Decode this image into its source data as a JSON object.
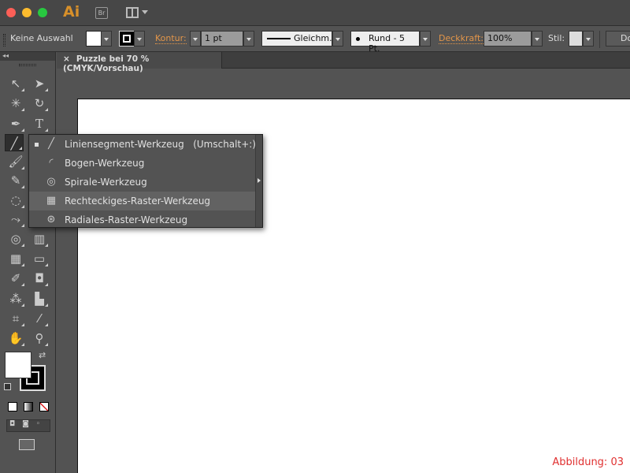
{
  "app": {
    "logo": "Ai",
    "bridge": "Br"
  },
  "control": {
    "selection": "Keine Auswahl",
    "stroke_label": "Kontur:",
    "stroke_weight": "1 pt",
    "stroke_profile": "Gleichm.",
    "brush": "Rund - 5 Pt.",
    "opacity_label": "Deckkraft:",
    "opacity": "100%",
    "style_label": "Stil:",
    "doc_button": "Do"
  },
  "tab": {
    "close": "×",
    "title": "Puzzle bei 70 % (CMYK/Vorschau)"
  },
  "panel": {
    "collapse": "◂◂"
  },
  "flyout": {
    "items": [
      {
        "label": "Liniensegment-Werkzeug   (Umschalt+:)",
        "icon": "line-segment-icon",
        "selected": true
      },
      {
        "label": "Bogen-Werkzeug",
        "icon": "arc-icon"
      },
      {
        "label": "Spirale-Werkzeug",
        "icon": "spiral-icon"
      },
      {
        "label": "Rechteckiges-Raster-Werkzeug",
        "icon": "rect-grid-icon",
        "highlighted": true
      },
      {
        "label": "Radiales-Raster-Werkzeug",
        "icon": "polar-grid-icon"
      }
    ]
  },
  "caption": "Abbildung: 03",
  "colors": {
    "accent": "#e3964a",
    "caption": "#e03030"
  }
}
